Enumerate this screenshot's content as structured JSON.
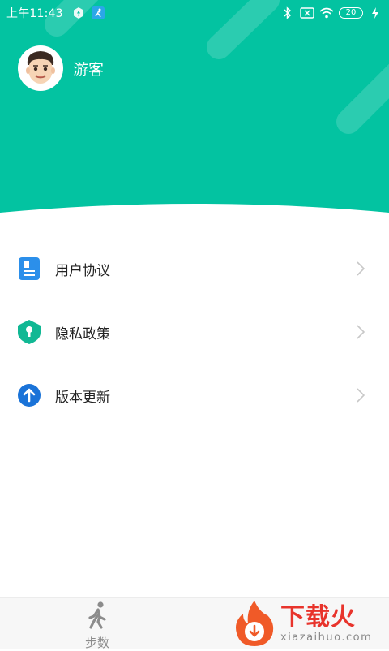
{
  "status_bar": {
    "time": "上午11:43",
    "battery": "20"
  },
  "colors": {
    "header": "#03c3a1",
    "doc_icon": "#2b8fea",
    "shield_icon": "#11b894",
    "update_icon": "#1a73d8"
  },
  "profile": {
    "name": "游客"
  },
  "menu": {
    "items": [
      {
        "label": "用户协议",
        "icon": "document-icon"
      },
      {
        "label": "隐私政策",
        "icon": "shield-lock-icon"
      },
      {
        "label": "版本更新",
        "icon": "upload-arrow-icon"
      }
    ]
  },
  "tabbar": {
    "steps_label": "步数"
  },
  "watermark": {
    "title": "下载火",
    "subtitle": "xiazaihuo.com"
  }
}
